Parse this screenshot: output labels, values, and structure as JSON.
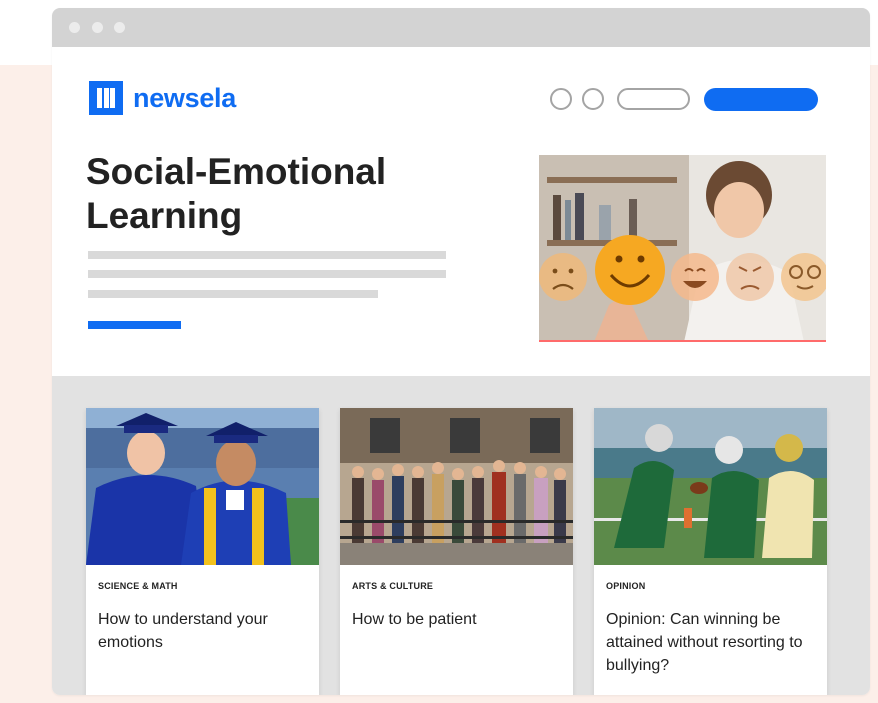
{
  "brand": {
    "name": "newsela",
    "color": "#0f6cf2"
  },
  "page": {
    "title": "Social-Emotional Learning"
  },
  "hero": {
    "image": "girl-touching-emoji-faces",
    "emojis": [
      "sad-face-icon",
      "happy-face-icon",
      "laughing-face-icon",
      "angry-face-icon",
      "glasses-face-icon"
    ]
  },
  "articles": [
    {
      "category": "SCIENCE & MATH",
      "title": "How to understand your emotions",
      "image": "graduates-in-gowns"
    },
    {
      "category": "ARTS & CULTURE",
      "title": "How to be patient",
      "image": "people-waiting-in-line"
    },
    {
      "category": "OPINION",
      "title": "Opinion: Can winning be attained without resorting to bullying?",
      "image": "football-players"
    }
  ],
  "colors": {
    "accent": "#0f6cf2",
    "background": "#fcefe9",
    "band": "#e2e2e2"
  }
}
